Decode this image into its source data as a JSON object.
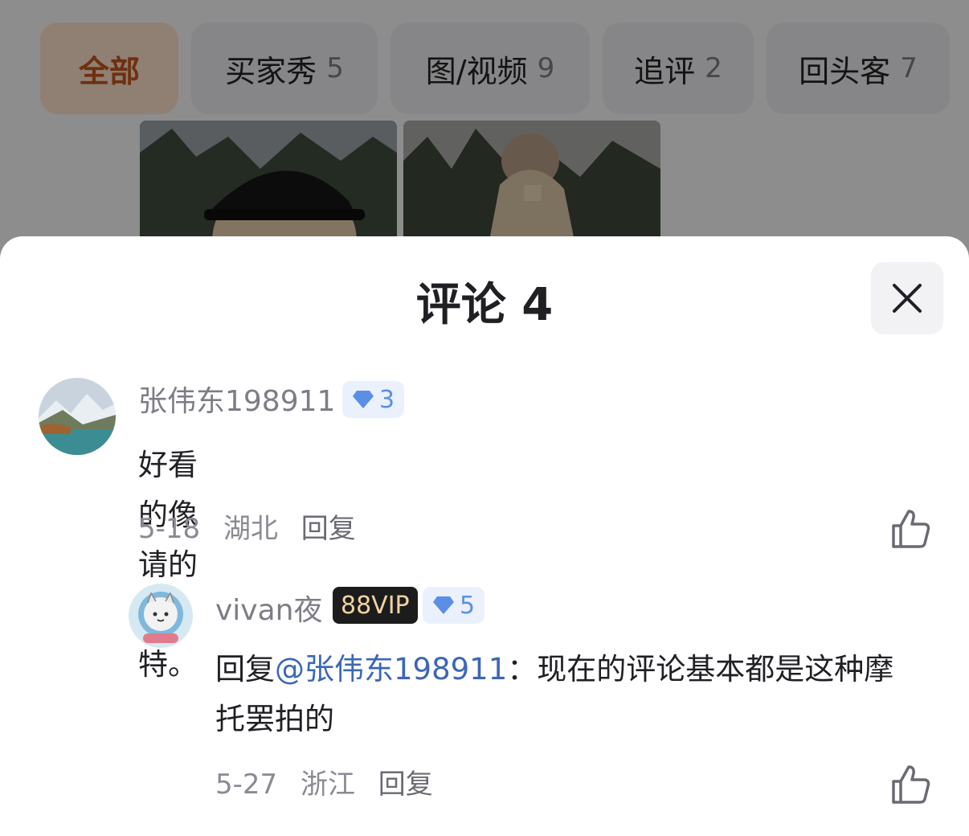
{
  "tabs": [
    {
      "label": "全部",
      "count": ""
    },
    {
      "label": "买家秀",
      "count": "5"
    },
    {
      "label": "图/视频",
      "count": "9"
    },
    {
      "label": "追评",
      "count": "2"
    },
    {
      "label": "回头客",
      "count": "7"
    }
  ],
  "sheet": {
    "title": "评论 4"
  },
  "comments": [
    {
      "username": "张伟东198911",
      "level": "3",
      "text": "好看的像请的模特。",
      "date": "5-18",
      "location": "湖北",
      "reply_label": "回复"
    },
    {
      "username": "vivan夜",
      "vip_label": "88VIP",
      "level": "5",
      "reply_prefix": "回复",
      "mention": "@张伟东198911",
      "separator": "：",
      "text": "现在的评论基本都是这种摩托罢拍的",
      "date": "5-27",
      "location": "浙江",
      "reply_label": "回复"
    }
  ],
  "icons": {
    "close": "close-icon",
    "like": "thumbs-up-icon",
    "level": "diamond-icon"
  },
  "colors": {
    "active_tab": "#c0531d",
    "mention": "#3c67b6",
    "level_badge": "#5b8ee6",
    "vip_gold": "#f0d3a2"
  }
}
